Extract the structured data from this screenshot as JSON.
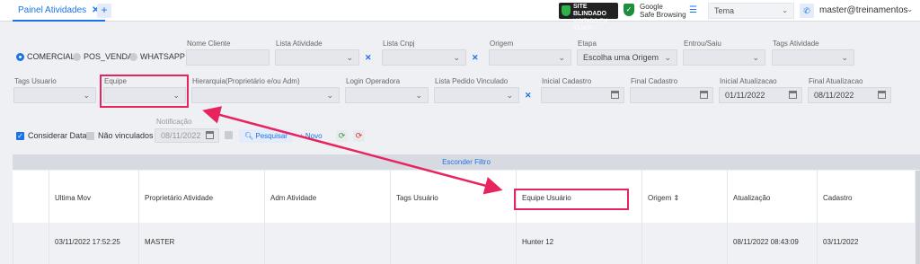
{
  "topbar": {
    "tab_label": "Painel Atividades",
    "tab_close": "✕",
    "add_tab": "+",
    "site_blindado_l1": "SITE BLINDADO",
    "site_blindado_l2": "VISITADO EM 03-NOV",
    "google_l1": "Google",
    "google_l2": "Safe Browsing",
    "theme_value": "Tema",
    "user": "master@treinamentos"
  },
  "filters": {
    "radio_options": [
      "COMERCIAL",
      "POS_VENDA",
      "WHATSAPP"
    ],
    "radio_selected": "COMERCIAL",
    "labels": {
      "nome_cliente": "Nome Cliente",
      "lista_atividade": "Lista Atividade",
      "lista_cnpj": "Lista Cnpj",
      "origem": "Origem",
      "etapa": "Etapa",
      "entrou_saiu": "Entrou/Saiu",
      "tags_atividade": "Tags Atividade",
      "tags_usuario": "Tags Usuario",
      "equipe": "Equipe",
      "hierarquia": "Hierarquia(Proprietário e/ou Adm)",
      "login_operadora": "Login Operadora",
      "lista_pedido": "Lista Pedido Vinculado",
      "inicial_cadastro": "Inicial Cadastro",
      "final_cadastro": "Final Cadastro",
      "inicial_atualizacao": "Inicial Atualizacao",
      "final_atualizacao": "Final Atualizacao",
      "notificacao": "Notificação"
    },
    "values": {
      "etapa": "Escolha uma Origem",
      "inicial_atualizacao": "01/11/2022",
      "final_atualizacao": "08/11/2022",
      "notificacao": "08/11/2022"
    },
    "considerar_data": "Considerar Data",
    "nao_vinculados": "Não vinculados",
    "pesquisar": "Pesquisar",
    "novo": "Novo",
    "esconder_filtro": "Esconder Filtro"
  },
  "table": {
    "columns": [
      "Ultima Mov",
      "Proprietário Atividade",
      "Adm Atividade",
      "Tags Usuário",
      "Equipe Usuário",
      "Origem",
      "Atualização",
      "Cadastro"
    ],
    "rows": [
      [
        "03/11/2022 17:52:25",
        "MASTER",
        "",
        "",
        "Hunter 12",
        "",
        "08/11/2022 08:43:09",
        "03/11/2022"
      ]
    ]
  },
  "colors": {
    "accent": "#1a73e8",
    "annotation": "#e8245f"
  }
}
